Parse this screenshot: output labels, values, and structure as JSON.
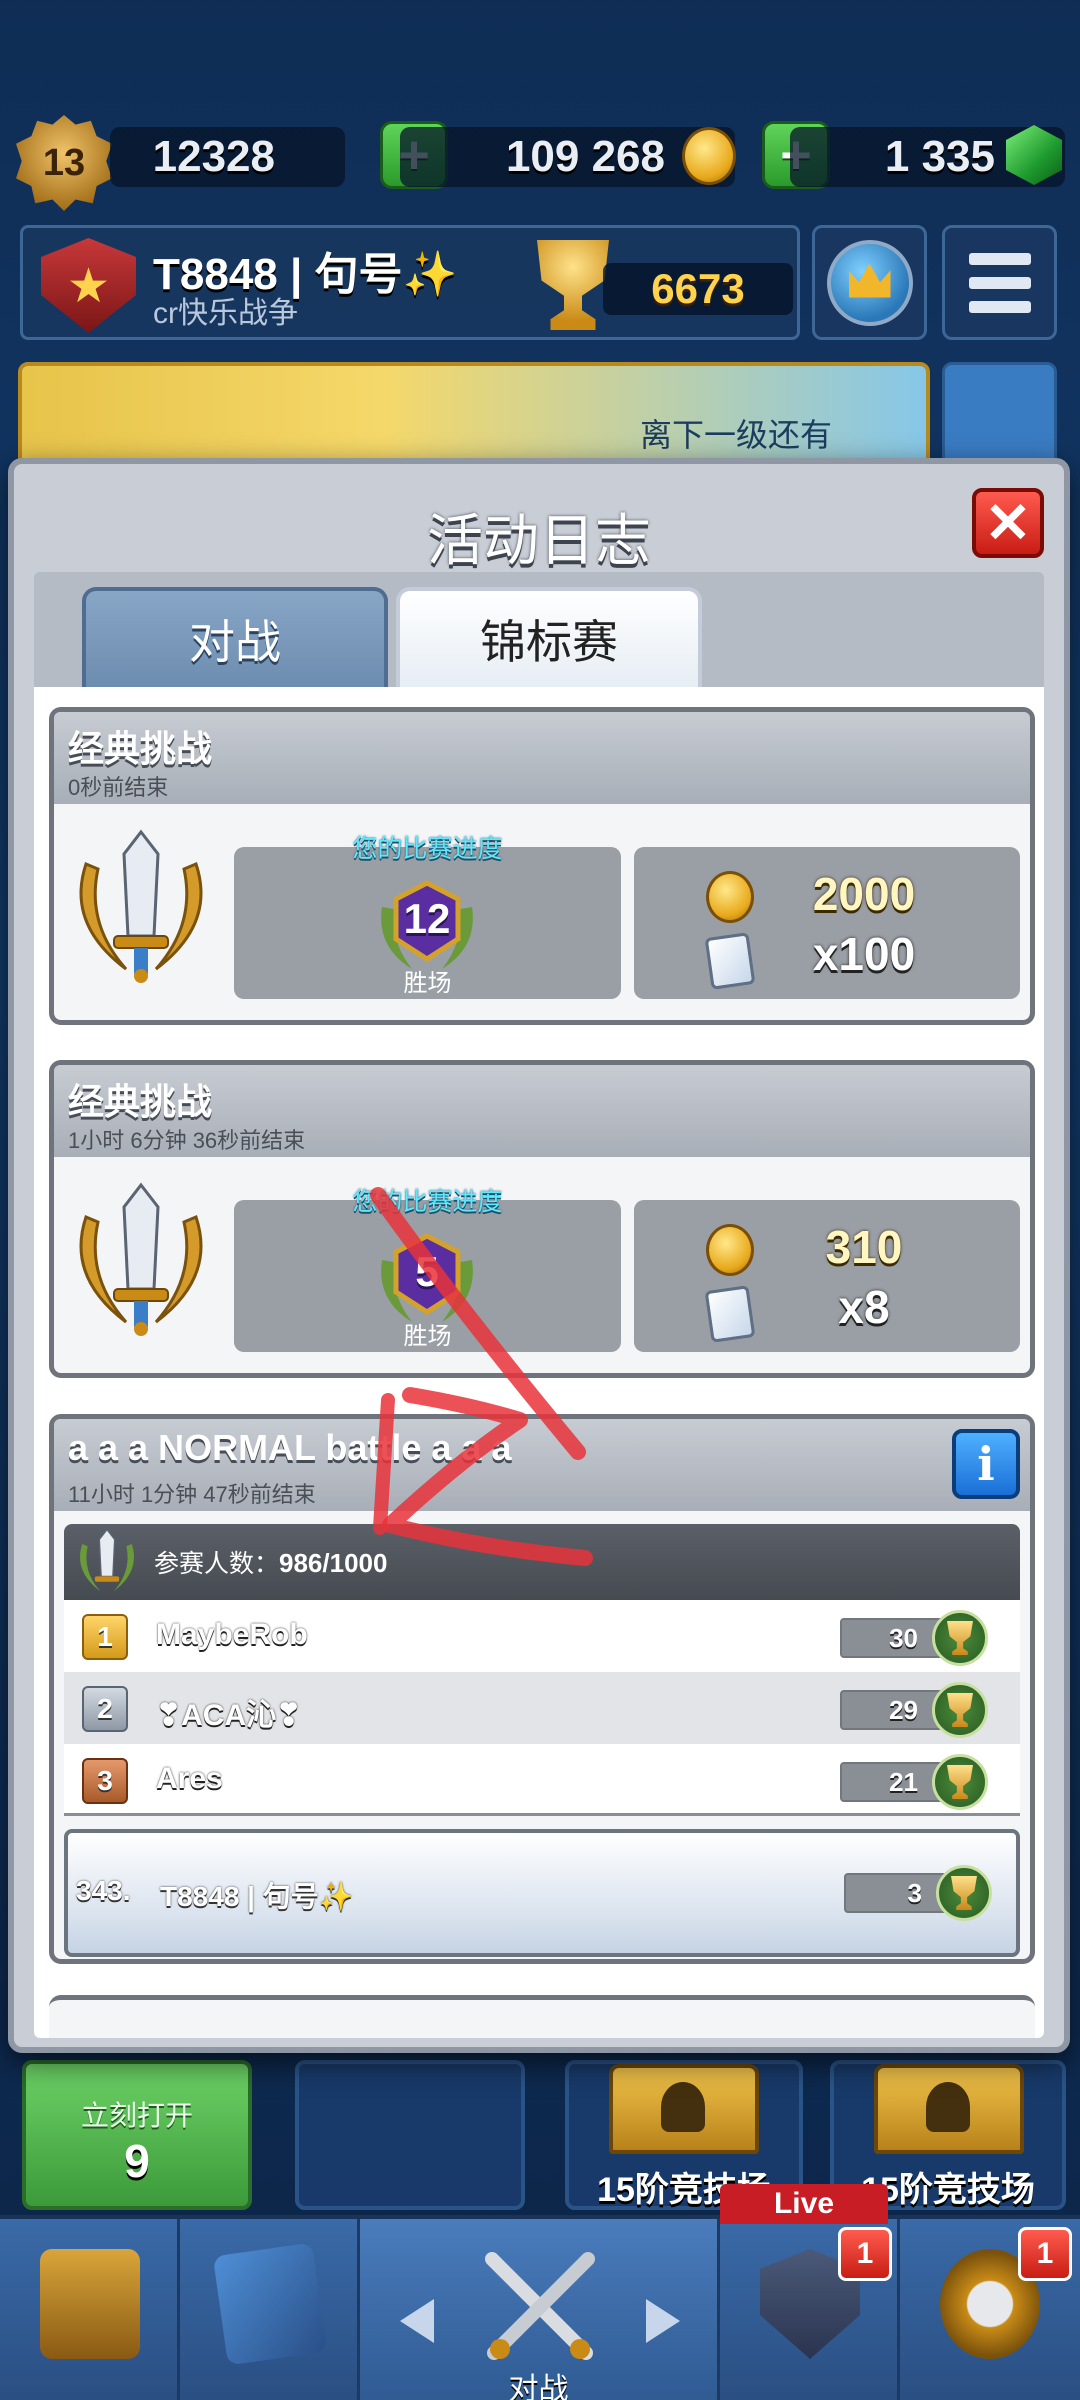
{
  "player": {
    "level": "13",
    "xp": "12328",
    "gold": "109 268",
    "gems": "1 335",
    "name": "T8848 | 句号✨",
    "clan": "cr快乐战争",
    "trophies": "6673"
  },
  "pass_banner": {
    "label": "离下一级还有"
  },
  "modal": {
    "title": "活动日志",
    "tabs": [
      {
        "label": "对战",
        "active": false
      },
      {
        "label": "锦标赛",
        "active": true
      }
    ]
  },
  "challenges": [
    {
      "title": "经典挑战",
      "subtitle": "0秒前结束",
      "progress_label": "您的比赛进度",
      "wins": "12",
      "wins_label": "胜场",
      "gold_reward": "2000",
      "card_reward": "x100"
    },
    {
      "title": "经典挑战",
      "subtitle": "1小时 6分钟  36秒前结束",
      "progress_label": "您的比赛进度",
      "wins": "5",
      "wins_label": "胜场",
      "gold_reward": "310",
      "card_reward": "x8"
    }
  ],
  "tournament": {
    "title": "a a a NORMAL battle a a a",
    "subtitle": "11小时 1分钟  47秒前结束",
    "participants_label": "参赛人数：",
    "participants": "986/1000",
    "leaderboard": [
      {
        "rank": "1",
        "name": "MaybeRob",
        "score": "30"
      },
      {
        "rank": "2",
        "name": "❣ACA沁❣",
        "score": "29"
      },
      {
        "rank": "3",
        "name": "Ares",
        "score": "21"
      }
    ],
    "me": {
      "rank": "343.",
      "name": "T8848 | 句号✨",
      "score": "3"
    }
  },
  "chest_slots": [
    {
      "type": "unlock",
      "label": "立刻打开",
      "cost": "9"
    },
    {
      "type": "empty",
      "label": ""
    },
    {
      "type": "chest",
      "label": "15阶竞技场"
    },
    {
      "type": "chest",
      "label": "15阶竞技场"
    }
  ],
  "navbar": {
    "battle_label": "对战",
    "live_tag": "Live",
    "clan_badge": "1",
    "events_badge": "1"
  },
  "colors": {
    "modal_bg": "#c9ced6",
    "close_red": "#c81d14",
    "progress_cyan": "#5de8ff",
    "annotation_red": "#e8333a"
  }
}
